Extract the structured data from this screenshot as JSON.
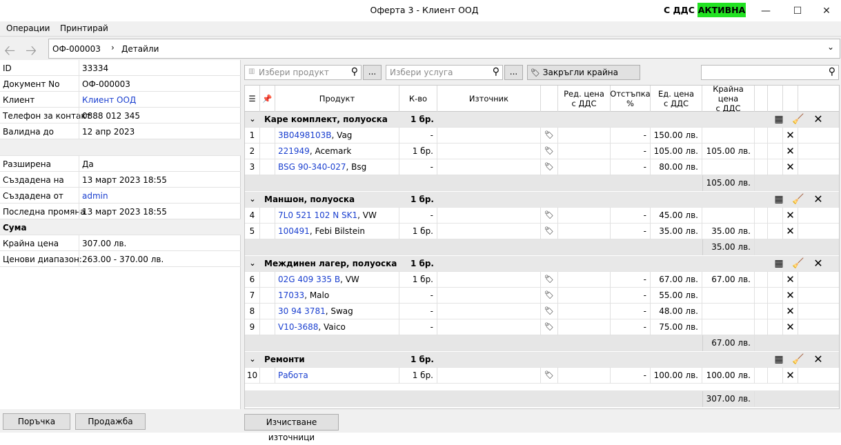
{
  "window": {
    "title": "Оферта 3 - Клиент ООД",
    "vat_label": "С ДДС",
    "status_badge": "АКТИВНА",
    "status_color": "#22e222"
  },
  "menu": [
    "Операции",
    "Принтирай"
  ],
  "breadcrumb": {
    "doc": "ОФ-000003",
    "page": "Детайли"
  },
  "properties": [
    {
      "key": "ID",
      "value": "33334"
    },
    {
      "key": "Документ No",
      "value": "ОФ-000003"
    },
    {
      "key": "Клиент",
      "value": "Клиент ООД",
      "link": true
    },
    {
      "key": "Телефон за контакт",
      "value": "0888 012 345"
    },
    {
      "key": "Валидна до",
      "value": "12 апр 2023"
    }
  ],
  "properties2": [
    {
      "key": "Разширена",
      "value": "Да"
    },
    {
      "key": "Създадена на",
      "value": "13 март 2023 18:55"
    },
    {
      "key": "Създадена от",
      "value": "admin",
      "link": true
    },
    {
      "key": "Последна промяна",
      "value": "13 март 2023 18:55"
    }
  ],
  "sum_header": "Сума",
  "sums": [
    {
      "key": "Крайна цена",
      "value": "307.00 лв."
    },
    {
      "key": "Ценови диапазон:",
      "value": "263.00 - 370.00 лв."
    }
  ],
  "left_buttons": {
    "order": "Поръчка",
    "sale": "Продажба"
  },
  "toolbar": {
    "product_placeholder": "Избери продукт",
    "service_placeholder": "Избери услуга",
    "ellipsis": "...",
    "round_label": "Закръгли крайна цена"
  },
  "columns": {
    "product": "Продукт",
    "qty": "К-во",
    "source": "Източник",
    "reg_price_1": "Ред. цена",
    "reg_price_2": "с ДДС",
    "discount_1": "Отстъпка",
    "discount_2": "%",
    "unit_price_1": "Ед. цена",
    "unit_price_2": "с ДДС",
    "final_price_1": "Крайна цена",
    "final_price_2": "с ДДС"
  },
  "groups": [
    {
      "name": "Каре комплект, полуоска",
      "qty": "1 бр.",
      "total": "105.00 лв.",
      "rows": [
        {
          "n": "1",
          "code": "3B0498103B",
          "brand": ", Vag",
          "qty": "-",
          "disc": "-",
          "unit": "150.00 лв.",
          "final": ""
        },
        {
          "n": "2",
          "code": "221949",
          "brand": ", Acemark",
          "qty": "1 бр.",
          "disc": "-",
          "unit": "105.00 лв.",
          "final": "105.00 лв."
        },
        {
          "n": "3",
          "code": "BSG 90-340-027",
          "brand": ", Bsg",
          "qty": "-",
          "disc": "-",
          "unit": "80.00 лв.",
          "final": ""
        }
      ]
    },
    {
      "name": "Маншон, полуоска",
      "qty": "1 бр.",
      "total": "35.00 лв.",
      "rows": [
        {
          "n": "4",
          "code": "7L0 521 102 N SK1",
          "brand": ", VW",
          "qty": "-",
          "disc": "-",
          "unit": "45.00 лв.",
          "final": ""
        },
        {
          "n": "5",
          "code": "100491",
          "brand": ", Febi Bilstein",
          "qty": "1 бр.",
          "disc": "-",
          "unit": "35.00 лв.",
          "final": "35.00 лв."
        }
      ]
    },
    {
      "name": "Междинен лагер, полуоска",
      "qty": "1 бр.",
      "total": "67.00 лв.",
      "rows": [
        {
          "n": "6",
          "code": "02G 409 335 B",
          "brand": ", VW",
          "qty": "1 бр.",
          "disc": "-",
          "unit": "67.00 лв.",
          "final": "67.00 лв."
        },
        {
          "n": "7",
          "code": "17033",
          "brand": ", Malo",
          "qty": "-",
          "disc": "-",
          "unit": "55.00 лв.",
          "final": ""
        },
        {
          "n": "8",
          "code": "30 94 3781",
          "brand": ", Swag",
          "qty": "-",
          "disc": "-",
          "unit": "48.00 лв.",
          "final": ""
        },
        {
          "n": "9",
          "code": "V10-3688",
          "brand": ", Vaico",
          "qty": "-",
          "disc": "-",
          "unit": "75.00 лв.",
          "final": ""
        }
      ]
    },
    {
      "name": "Ремонти",
      "qty": "1 бр.",
      "total": null,
      "rows": [
        {
          "n": "10",
          "code": "Работа",
          "brand": "",
          "qty": "1 бр.",
          "disc": "-",
          "unit": "100.00 лв.",
          "final": "100.00 лв."
        }
      ]
    }
  ],
  "grand_total": "307.00 лв.",
  "clear_sources_label": "Изчистване източници"
}
